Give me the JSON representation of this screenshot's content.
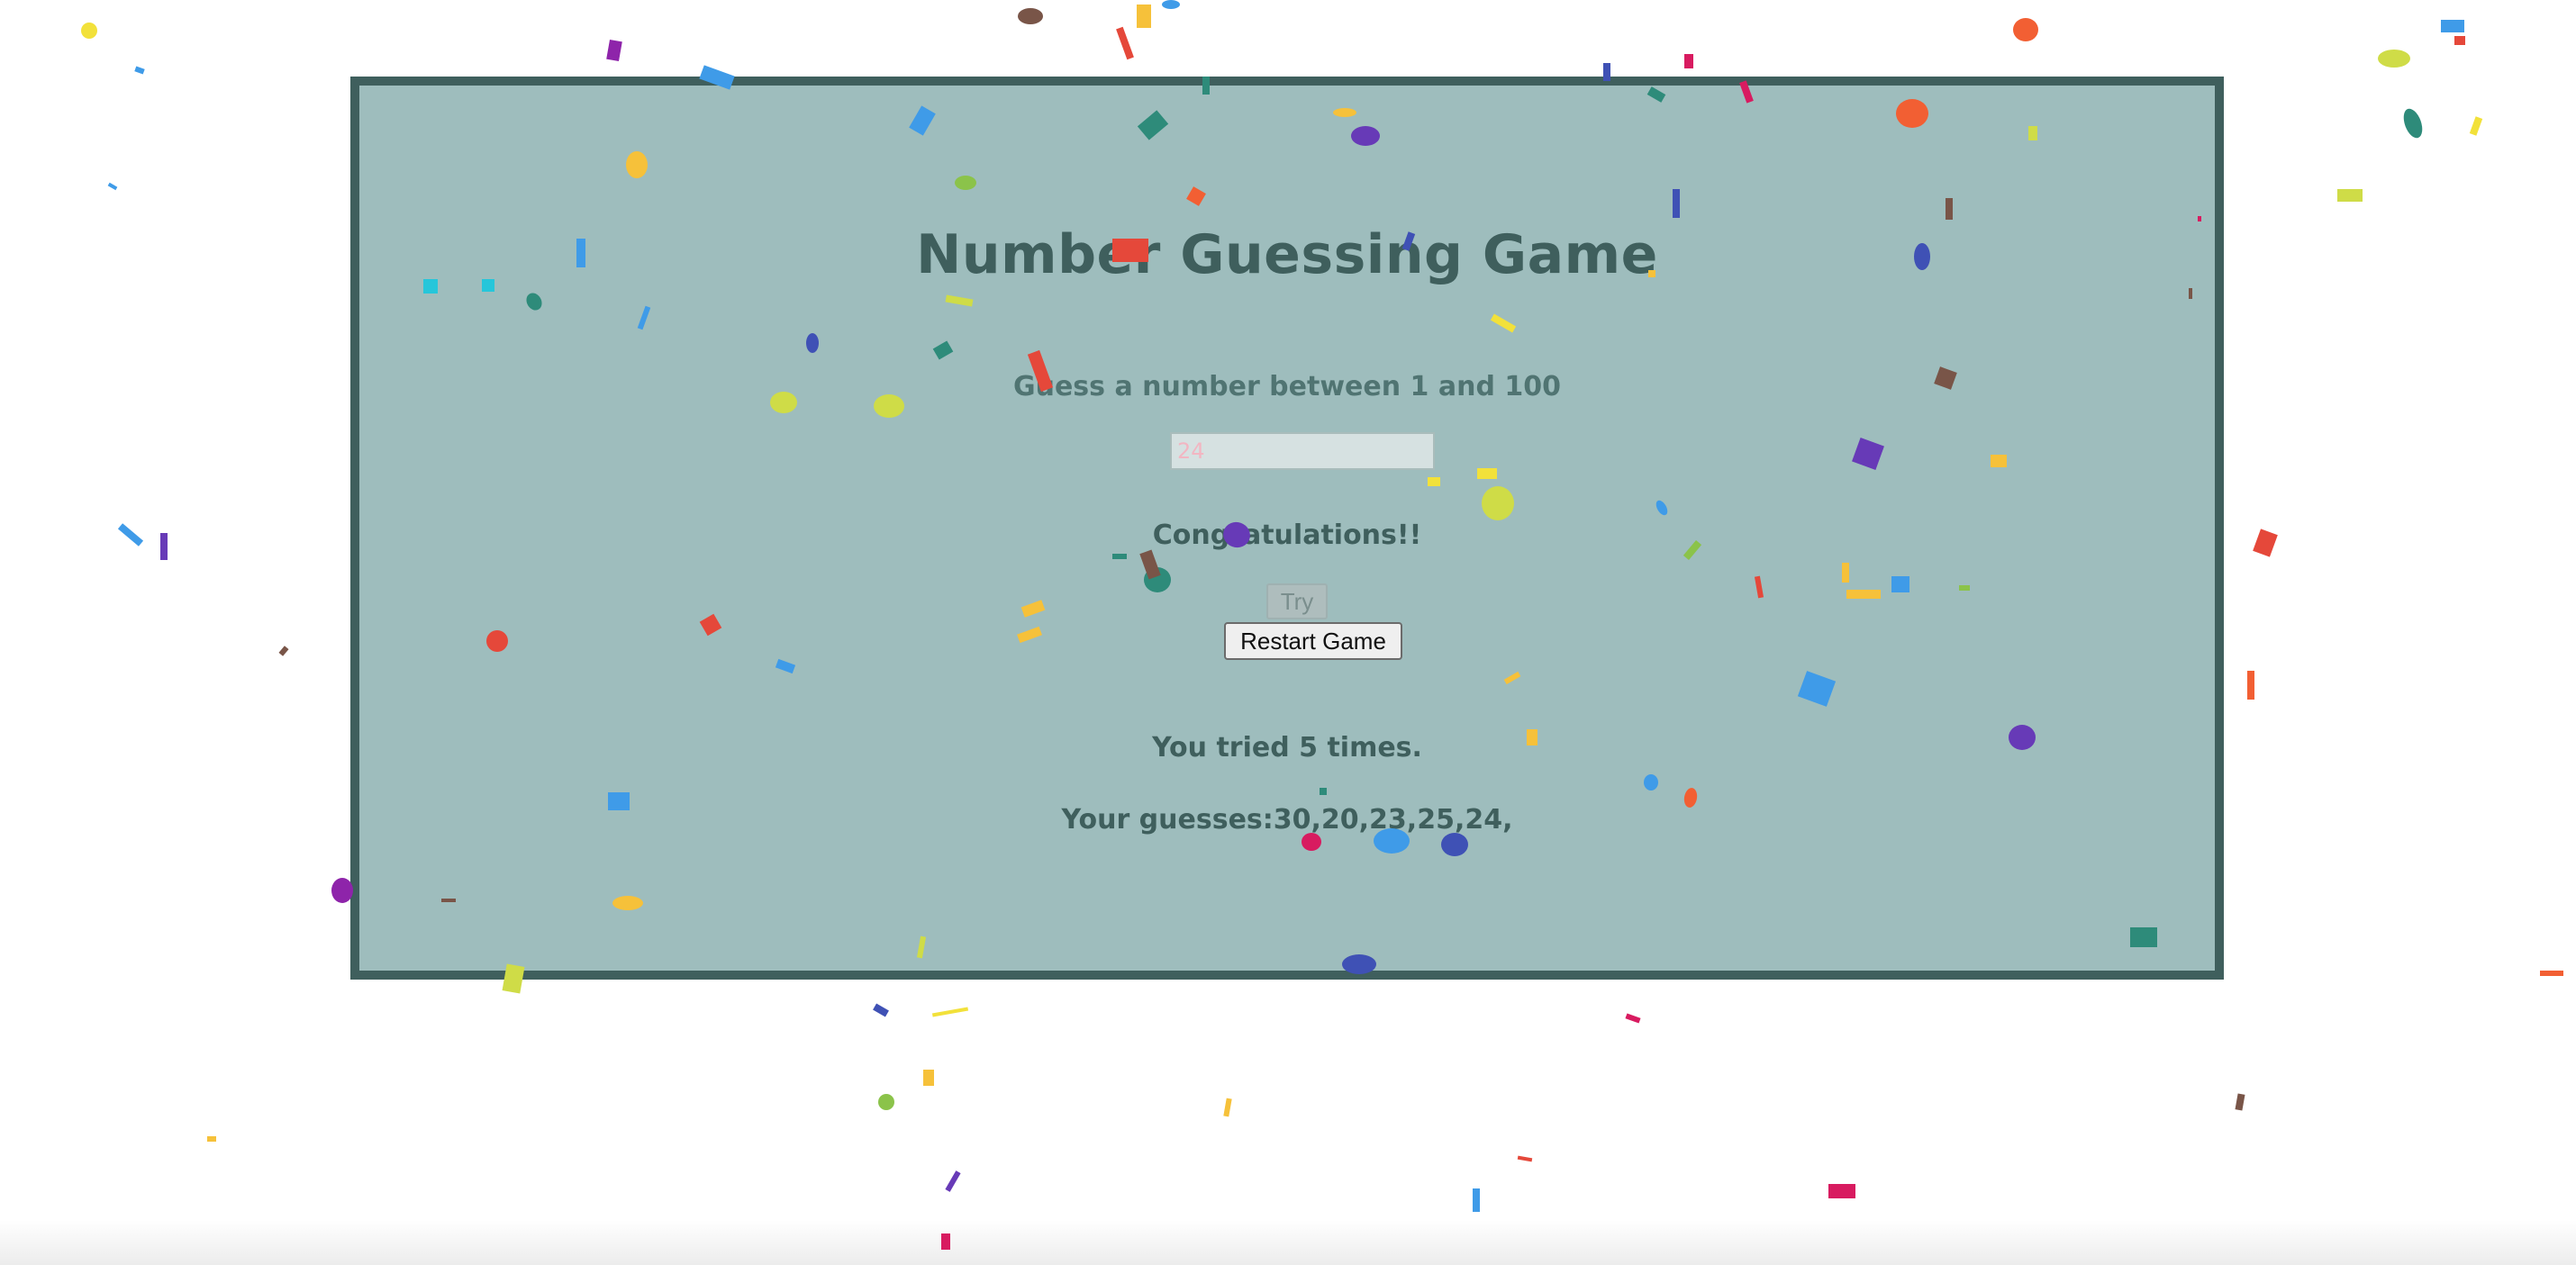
{
  "game": {
    "title": "Number Guessing Game",
    "instructions": "Guess a number between 1 and 100",
    "input_value": "24",
    "result_message": "Congratulations!!",
    "try_label": "Try",
    "restart_label": "Restart Game",
    "tries_text": "You tried 5 times.",
    "guesses_text": "Your guesses:30,20,23,25,24,"
  },
  "colors": {
    "page_background": "#ffffff",
    "panel_background": "#9ebdbd",
    "panel_border": "#3f5f5d",
    "text": "#3f5f5d",
    "confetti": [
      "#e5483a",
      "#f25f33",
      "#f6c13a",
      "#f2e13a",
      "#cfdc47",
      "#8bc34a",
      "#2e8b7a",
      "#3f9be8",
      "#3f51b5",
      "#673ab7",
      "#8e24aa",
      "#d81b60",
      "#795548",
      "#26c6da"
    ]
  }
}
